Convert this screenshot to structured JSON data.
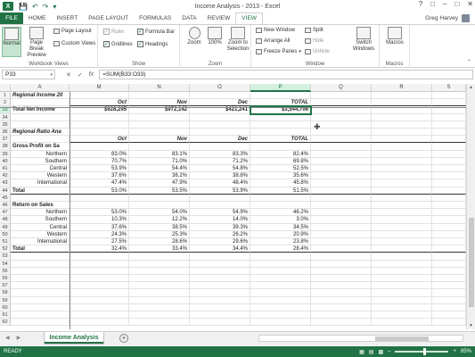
{
  "window": {
    "title": "Income Analysis - 2013 - Excel",
    "app_letter": "X",
    "qat_icons": [
      "save-icon",
      "undo-icon",
      "redo-icon",
      "customize-icon"
    ],
    "controls": [
      "?",
      "□",
      "–",
      "□",
      "✕"
    ]
  },
  "ribbon_tabs": {
    "file": "FILE",
    "tabs": [
      "HOME",
      "INSERT",
      "PAGE LAYOUT",
      "FORMULAS",
      "DATA",
      "REVIEW",
      "VIEW"
    ],
    "active": "VIEW",
    "user": "Greg Harvey"
  },
  "ribbon": {
    "workbook_views": {
      "label": "Workbook Views",
      "normal": "Normal",
      "page_break": "Page Break Preview",
      "page_layout": "Page Layout",
      "custom_views": "Custom Views"
    },
    "show": {
      "label": "Show",
      "ruler": "Ruler",
      "formula_bar": "Formula Bar",
      "gridlines": "Gridlines",
      "headings": "Headings"
    },
    "zoom": {
      "label": "Zoom",
      "zoom": "Zoom",
      "hundred": "100%",
      "zoom_to_selection": "Zoom to Selection"
    },
    "window": {
      "label": "Window",
      "new_window": "New Window",
      "arrange_all": "Arrange All",
      "freeze_panes": "Freeze Panes",
      "split": "Split",
      "hide": "Hide",
      "unhide": "Unhide",
      "switch_windows": "Switch Windows"
    },
    "macros": {
      "label": "Macros",
      "macros": "Macros"
    }
  },
  "formula_bar": {
    "name_box": "P33",
    "cancel": "✕",
    "enter": "✓",
    "fx": "fx",
    "formula": "=SUM(B33:O33)"
  },
  "grid": {
    "columns": [
      "A",
      "M",
      "N",
      "O",
      "P",
      "Q",
      "R",
      "S"
    ],
    "selected_column": "P",
    "selected_row": "33",
    "rows": [
      {
        "n": "1",
        "a": "Regional Income 20",
        "m": "",
        "nn": "",
        "o": "",
        "p": "",
        "style": "title"
      },
      {
        "n": "2",
        "a": "",
        "m": "Oct",
        "nn": "Nov",
        "o": "Dec",
        "p": "TOTAL",
        "style": "header"
      },
      {
        "n": "33",
        "a": "Total Net Income",
        "m": "$928,295",
        "nn": "$972,142",
        "o": "$421,241",
        "p": "$3,544,706",
        "style": "total"
      },
      {
        "n": "34",
        "a": "",
        "m": "",
        "nn": "",
        "o": "",
        "p": "",
        "style": ""
      },
      {
        "n": "35",
        "a": "",
        "m": "",
        "nn": "",
        "o": "",
        "p": "",
        "style": ""
      },
      {
        "n": "36",
        "a": "Regional Ratio Ana",
        "m": "",
        "nn": "",
        "o": "",
        "p": "",
        "style": "title"
      },
      {
        "n": "37",
        "a": "",
        "m": "Oct",
        "nn": "Nov",
        "o": "Dec",
        "p": "TOTAL",
        "style": "header"
      },
      {
        "n": "38",
        "a": "Gross Profit on Sa",
        "m": "",
        "nn": "",
        "o": "",
        "p": "",
        "style": "section"
      },
      {
        "n": "39",
        "a": "Northern",
        "m": "83.0%",
        "nn": "83.1%",
        "o": "83.3%",
        "p": "82.4%",
        "style": "region"
      },
      {
        "n": "40",
        "a": "Southern",
        "m": "70.7%",
        "nn": "71.0%",
        "o": "71.2%",
        "p": "69.8%",
        "style": "region"
      },
      {
        "n": "41",
        "a": "Central",
        "m": "53.9%",
        "nn": "54.4%",
        "o": "54.8%",
        "p": "52.5%",
        "style": "region"
      },
      {
        "n": "42",
        "a": "Western",
        "m": "37.6%",
        "nn": "38.2%",
        "o": "38.8%",
        "p": "35.6%",
        "style": "region"
      },
      {
        "n": "43",
        "a": "International",
        "m": "47.4%",
        "nn": "47.9%",
        "o": "48.4%",
        "p": "45.8%",
        "style": "region"
      },
      {
        "n": "44",
        "a": "Total",
        "m": "53.0%",
        "nn": "53.5%",
        "o": "53.9%",
        "p": "51.5%",
        "style": "sectiontotal"
      },
      {
        "n": "45",
        "a": "",
        "m": "",
        "nn": "",
        "o": "",
        "p": "",
        "style": ""
      },
      {
        "n": "46",
        "a": "Return on Sales",
        "m": "",
        "nn": "",
        "o": "",
        "p": "",
        "style": "section"
      },
      {
        "n": "47",
        "a": "Northern",
        "m": "53.0%",
        "nn": "54.0%",
        "o": "54.9%",
        "p": "46.2%",
        "style": "region"
      },
      {
        "n": "48",
        "a": "Southern",
        "m": "10.3%",
        "nn": "12.2%",
        "o": "14.0%",
        "p": "3.0%",
        "style": "region"
      },
      {
        "n": "49",
        "a": "Central",
        "m": "37.6%",
        "nn": "38.5%",
        "o": "39.3%",
        "p": "34.5%",
        "style": "region"
      },
      {
        "n": "50",
        "a": "Western",
        "m": "24.3%",
        "nn": "25.3%",
        "o": "26.2%",
        "p": "20.9%",
        "style": "region"
      },
      {
        "n": "51",
        "a": "International",
        "m": "27.5%",
        "nn": "28.6%",
        "o": "29.6%",
        "p": "23.8%",
        "style": "region"
      },
      {
        "n": "52",
        "a": "Total",
        "m": "32.4%",
        "nn": "33.4%",
        "o": "34.4%",
        "p": "28.4%",
        "style": "sectiontotal"
      },
      {
        "n": "53",
        "a": "",
        "m": "",
        "nn": "",
        "o": "",
        "p": "",
        "style": ""
      },
      {
        "n": "54",
        "a": "",
        "m": "",
        "nn": "",
        "o": "",
        "p": "",
        "style": ""
      },
      {
        "n": "55",
        "a": "",
        "m": "",
        "nn": "",
        "o": "",
        "p": "",
        "style": ""
      },
      {
        "n": "56",
        "a": "",
        "m": "",
        "nn": "",
        "o": "",
        "p": "",
        "style": ""
      },
      {
        "n": "57",
        "a": "",
        "m": "",
        "nn": "",
        "o": "",
        "p": "",
        "style": ""
      },
      {
        "n": "58",
        "a": "",
        "m": "",
        "nn": "",
        "o": "",
        "p": "",
        "style": ""
      },
      {
        "n": "59",
        "a": "",
        "m": "",
        "nn": "",
        "o": "",
        "p": "",
        "style": ""
      },
      {
        "n": "60",
        "a": "",
        "m": "",
        "nn": "",
        "o": "",
        "p": "",
        "style": ""
      },
      {
        "n": "61",
        "a": "",
        "m": "",
        "nn": "",
        "o": "",
        "p": "",
        "style": ""
      },
      {
        "n": "62",
        "a": "",
        "m": "",
        "nn": "",
        "o": "",
        "p": "",
        "style": ""
      }
    ]
  },
  "sheets": {
    "active": "Income Analysis",
    "add": "+"
  },
  "status": {
    "ready": "READY",
    "zoom": "85%"
  },
  "colors": {
    "accent": "#217346",
    "selection_fill": "#d3f0e0"
  }
}
